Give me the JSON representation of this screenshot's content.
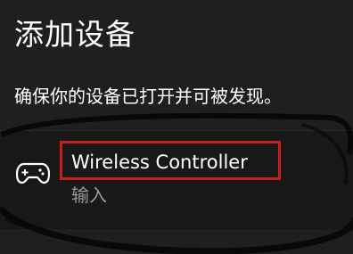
{
  "dialog": {
    "title": "添加设备",
    "subtitle": "确保你的设备已打开并可被发现。"
  },
  "device": {
    "name": "Wireless Controller",
    "type": "输入",
    "icon": "gamepad-icon",
    "highlight_color": "#c81e1e"
  },
  "colors": {
    "background": "#1f1f1f",
    "text_primary": "#ffffff",
    "text_secondary": "#9a9a9a"
  }
}
